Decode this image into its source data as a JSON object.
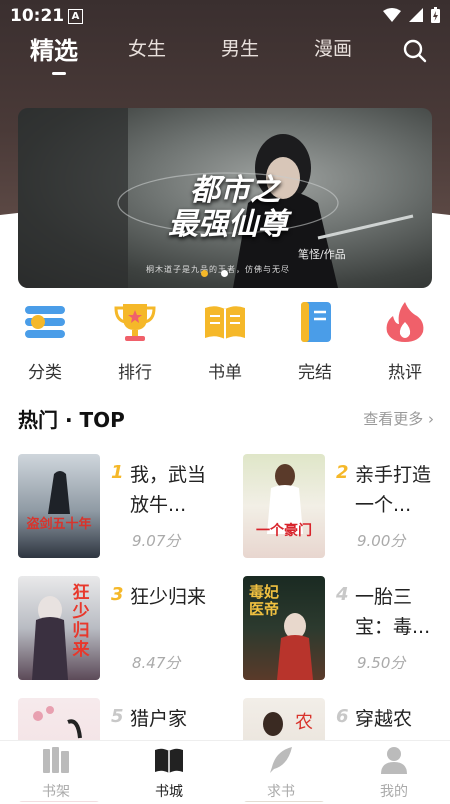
{
  "status": {
    "time": "10:21",
    "indicator": "A"
  },
  "nav": {
    "tabs": [
      "精选",
      "女生",
      "男生",
      "漫画"
    ],
    "active_tab": "精选"
  },
  "banner": {
    "title_line1": "都市之",
    "title_line2": "最强仙尊",
    "author": "笔怪/作品",
    "tagline": "桐木道子是九品的王者，仿佛与无尽",
    "slides": 2,
    "active_slide": 1
  },
  "categories": [
    {
      "label": "分类",
      "icon": "category-icon",
      "color": "#4a9de8"
    },
    {
      "label": "排行",
      "icon": "trophy-icon",
      "color": "#f5b829"
    },
    {
      "label": "书单",
      "icon": "book-list-icon",
      "color": "#f5b829"
    },
    {
      "label": "完结",
      "icon": "finished-icon",
      "color": "#4a9de8"
    },
    {
      "label": "热评",
      "icon": "hot-comment-icon",
      "color": "#f0606a"
    }
  ],
  "hot_section": {
    "title": "热门 · TOP",
    "more": "查看更多"
  },
  "books": [
    {
      "rank": "1",
      "title": "我，武当放牛...",
      "score": "9.07分",
      "cover_text": "盗剑五十年"
    },
    {
      "rank": "2",
      "title": "亲手打造一个...",
      "score": "9.00分",
      "cover_text": "一个豪门"
    },
    {
      "rank": "3",
      "title": "狂少归来",
      "score": "8.47分",
      "cover_text": "狂少归来"
    },
    {
      "rank": "4",
      "title": "一胎三宝：毒...",
      "score": "9.50分",
      "cover_text": "毒妃医帝"
    },
    {
      "rank": "5",
      "title": "猎户家",
      "score": "",
      "cover_text": ""
    },
    {
      "rank": "6",
      "title": "穿越农",
      "score": "",
      "cover_text": ""
    }
  ],
  "colors": {
    "rank_gold": "#f5b829",
    "rank_gray": "#c8c8c8",
    "accent_blue": "#4a9de8",
    "accent_red": "#f0606a"
  },
  "bottom_nav": [
    {
      "label": "书架",
      "icon": "bookshelf-icon"
    },
    {
      "label": "书城",
      "icon": "bookstore-icon",
      "active": true
    },
    {
      "label": "求书",
      "icon": "quill-icon"
    },
    {
      "label": "我的",
      "icon": "profile-icon"
    }
  ]
}
